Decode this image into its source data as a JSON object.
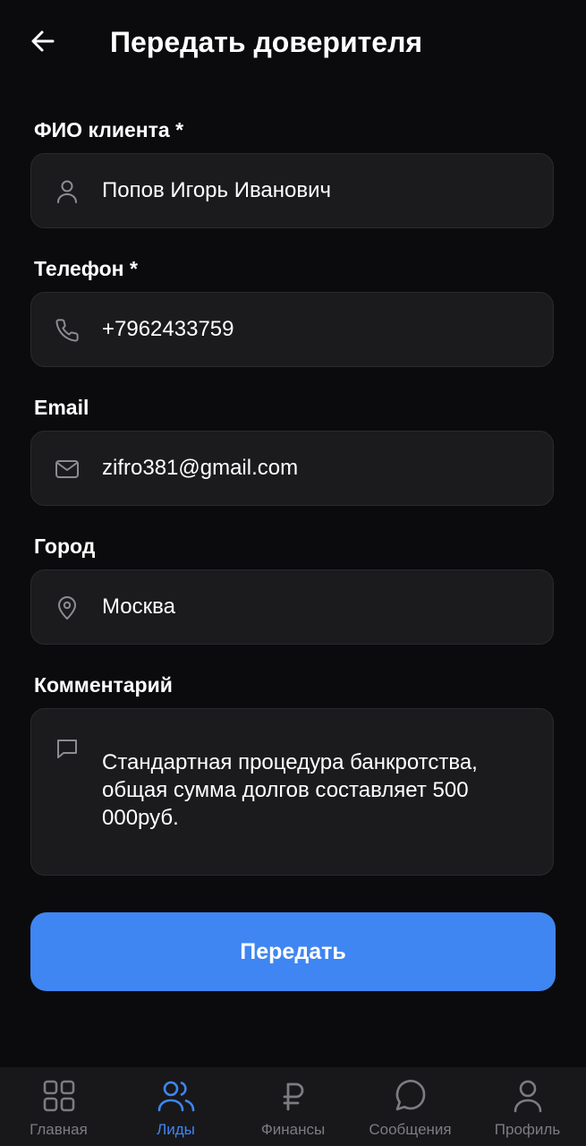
{
  "header": {
    "title": "Передать доверителя",
    "back_icon": "arrow-left-icon"
  },
  "form": {
    "name": {
      "label": "ФИО клиента *",
      "value": "Попов Игорь Иванович",
      "icon": "user-icon"
    },
    "phone": {
      "label": "Телефон *",
      "value": "+7962433759",
      "icon": "phone-icon"
    },
    "email": {
      "label": "Email",
      "value": "zifro381@gmail.com",
      "icon": "mail-icon"
    },
    "city": {
      "label": "Город",
      "value": "Москва",
      "icon": "map-pin-icon"
    },
    "comment": {
      "label": "Комментарий",
      "value": "Стандартная процедура банкротства, общая сумма долгов составляет 500 000руб.",
      "icon": "message-square-icon"
    },
    "submit_label": "Передать"
  },
  "nav": {
    "items": [
      {
        "label": "Главная",
        "icon": "grid-icon",
        "active": false
      },
      {
        "label": "Лиды",
        "icon": "users-icon",
        "active": true
      },
      {
        "label": "Финансы",
        "icon": "ruble-icon",
        "active": false
      },
      {
        "label": "Сообщения",
        "icon": "message-circle-icon",
        "active": false
      },
      {
        "label": "Профиль",
        "icon": "profile-icon",
        "active": false
      }
    ]
  },
  "colors": {
    "background": "#0b0b0d",
    "field_bg": "#1b1b1e",
    "accent": "#3f86f3",
    "muted": "#7c7c82"
  }
}
